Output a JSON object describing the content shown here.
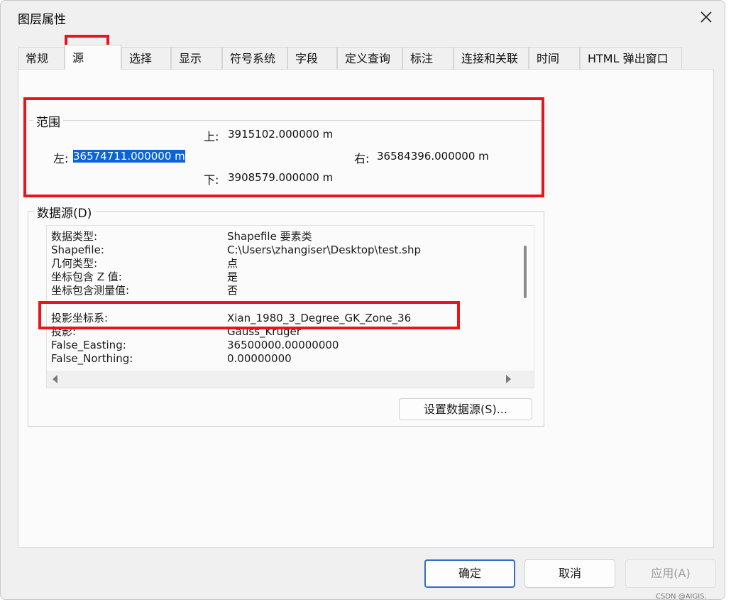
{
  "window": {
    "title": "图层属性"
  },
  "tabs": [
    "常规",
    "源",
    "选择",
    "显示",
    "符号系统",
    "字段",
    "定义查询",
    "标注",
    "连接和关联",
    "时间",
    "HTML 弹出窗口"
  ],
  "extent": {
    "legend": "范围",
    "top_label": "上:",
    "top_value": "3915102.000000 m",
    "left_label": "左:",
    "left_value": "36574711.000000 m",
    "right_label": "右:",
    "right_value": "36584396.000000 m",
    "bottom_label": "下:",
    "bottom_value": "3908579.000000 m"
  },
  "datasource": {
    "legend": "数据源(D)",
    "rows": [
      {
        "key": "数据类型:",
        "value": "Shapefile 要素类"
      },
      {
        "key": "Shapefile:",
        "value": "C:\\Users\\zhangiser\\Desktop\\test.shp"
      },
      {
        "key": "几何类型:",
        "value": "点"
      },
      {
        "key": "坐标包含 Z 值:",
        "value": "是"
      },
      {
        "key": "坐标包含测量值:",
        "value": "否"
      },
      {
        "key": "投影坐标系:",
        "value": "Xian_1980_3_Degree_GK_Zone_36"
      },
      {
        "key": "投影:",
        "value": "Gauss_Kruger"
      },
      {
        "key": "False_Easting:",
        "value": "36500000.00000000"
      },
      {
        "key": "False_Northing:",
        "value": "0.00000000"
      }
    ],
    "set_button": "设置数据源(S)..."
  },
  "buttons": {
    "ok": "确定",
    "cancel": "取消",
    "apply": "应用(A)"
  },
  "watermark": "CSDN @AIGIS.",
  "colors": {
    "highlight": "#e8161b",
    "selection": "#0a64d8",
    "primary_border": "#2f6fc7"
  }
}
